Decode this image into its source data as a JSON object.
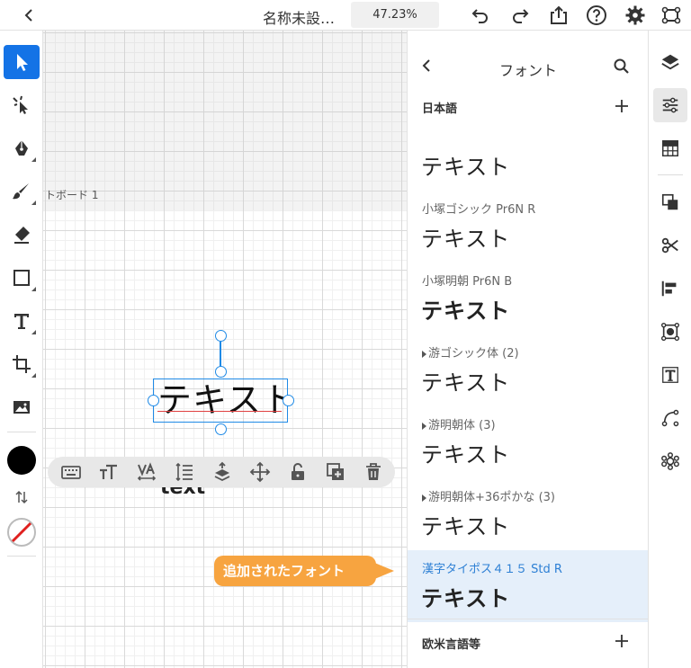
{
  "topbar": {
    "doc_title": "名称未設…",
    "zoom": "47.23%"
  },
  "canvas": {
    "artboard_label": "トボード 1",
    "selected_text": "テキスト",
    "partial_text_behind": "text",
    "callout": "追加されたフォント"
  },
  "colors": {
    "accent": "#1473e6",
    "selection": "#1f8ae6",
    "callout": "#f7a440",
    "selected_row": "#e5effa",
    "fill_swatch": "#000000",
    "stroke_none": "#e0201e"
  },
  "font_panel": {
    "title": "フォント",
    "japanese_section": "日本語",
    "western_section": "欧米言語等",
    "fonts": [
      {
        "name": "",
        "sample": "テキスト",
        "expandable": false
      },
      {
        "name": "小塚ゴシック Pr6N R",
        "sample": "テキスト",
        "expandable": false
      },
      {
        "name": "小塚明朝 Pr6N B",
        "sample": "テキスト",
        "expandable": false
      },
      {
        "name": "游ゴシック体 (2)",
        "sample": "テキスト",
        "expandable": true
      },
      {
        "name": "游明朝体 (3)",
        "sample": "テキスト",
        "expandable": true
      },
      {
        "name": "游明朝体+36ポかな (3)",
        "sample": "テキスト",
        "expandable": true
      },
      {
        "name": "漢字タイポス４１５ Std R",
        "sample": "テキスト",
        "expandable": false,
        "selected": true
      }
    ]
  },
  "icons": {
    "left_tools": [
      "select-icon",
      "direct-select-icon",
      "pen-icon",
      "brush-icon",
      "eraser-icon",
      "rectangle-icon",
      "type-icon",
      "crop-icon",
      "image-icon"
    ],
    "context_bar": [
      "keyboard-icon",
      "text-size-icon",
      "tracking-icon",
      "line-spacing-icon",
      "arrange-icon",
      "move-icon",
      "unlock-icon",
      "duplicate-icon",
      "trash-icon"
    ],
    "right_rail": [
      "layers-icon",
      "properties-icon",
      "swatches-icon",
      "pathfinder-icon",
      "scissors-icon",
      "align-icon",
      "repeat-icon",
      "text-icon",
      "path-icon",
      "plugins-icon"
    ]
  }
}
